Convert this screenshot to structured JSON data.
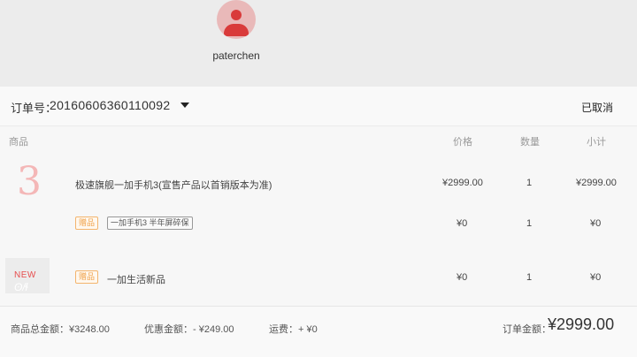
{
  "user": {
    "name": "paterchen"
  },
  "order": {
    "label": "订单号：",
    "number": "20160606360110092",
    "status": "已取消"
  },
  "table": {
    "headers": {
      "product": "商品",
      "price": "价格",
      "qty": "数量",
      "subtotal": "小计"
    },
    "rows": [
      {
        "thumb_text": "3",
        "name": "极速旗舰一加手机3(宣售产品以首销版本为准)",
        "price": "¥2999.00",
        "qty": "1",
        "subtotal": "¥2999.00"
      },
      {
        "tag": "赠品",
        "note": "一加手机3 半年屏碎保",
        "price": "¥0",
        "qty": "1",
        "subtotal": "¥0"
      },
      {
        "thumb_text": "NEW",
        "tag": "赠品",
        "name": "一加生活新品",
        "price": "¥0",
        "qty": "1",
        "subtotal": "¥0"
      }
    ]
  },
  "summary": {
    "goods_total": "商品总金额：¥3248.00",
    "discount": "优惠金额：- ¥249.00",
    "shipping": "运费：+ ¥0",
    "order_total_label": "订单金额：",
    "order_total": "¥2999.00"
  }
}
